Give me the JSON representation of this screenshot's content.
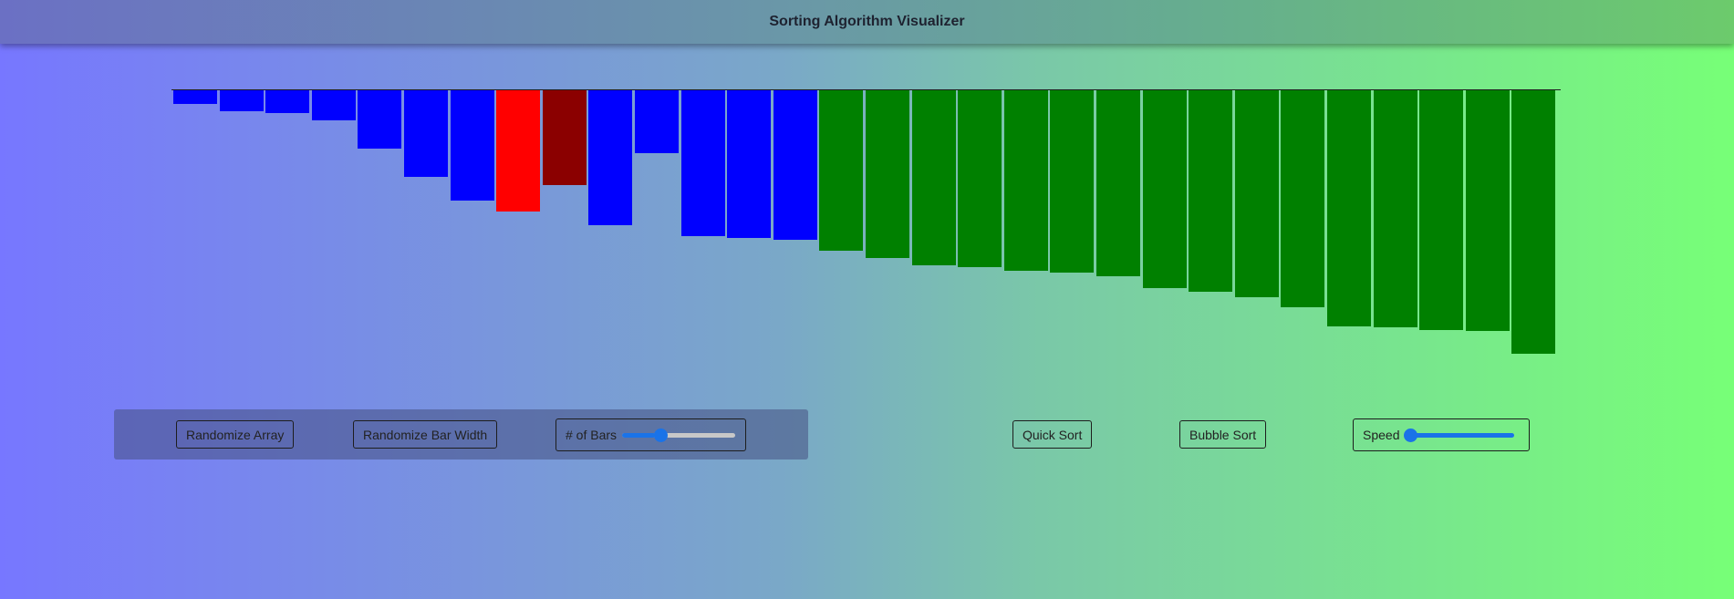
{
  "header": {
    "title": "Sorting Algorithm Visualizer"
  },
  "visualizer": {
    "bar_values": [
      15,
      23,
      25,
      33,
      64,
      95,
      121,
      133,
      104,
      148,
      69,
      160,
      162,
      164,
      176,
      184,
      192,
      194,
      198,
      200,
      204,
      217,
      221,
      227,
      238,
      259,
      260,
      263,
      264,
      289
    ],
    "bar_states": [
      "default",
      "default",
      "default",
      "default",
      "default",
      "default",
      "default",
      "comparing",
      "swapping",
      "default",
      "default",
      "default",
      "default",
      "default",
      "sorted",
      "sorted",
      "sorted",
      "sorted",
      "sorted",
      "sorted",
      "sorted",
      "sorted",
      "sorted",
      "sorted",
      "sorted",
      "sorted",
      "sorted",
      "sorted",
      "sorted",
      "sorted"
    ],
    "colors": {
      "default": "#0000ff",
      "comparing": "#ff0000",
      "swapping": "#8b0000",
      "sorted": "#008000"
    }
  },
  "controls": {
    "randomize_array_label": "Randomize Array",
    "randomize_bar_width_label": "Randomize Bar Width",
    "num_bars_label": "# of Bars",
    "num_bars_level_fraction": 0.3,
    "quick_sort_label": "Quick Sort",
    "bubble_sort_label": "Bubble Sort",
    "speed_label": "Speed",
    "speed_level_fraction": 0.0
  }
}
